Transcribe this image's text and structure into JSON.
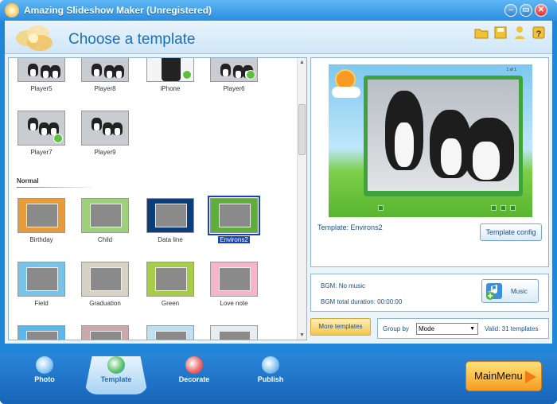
{
  "window": {
    "title": "Amazing Slideshow Maker (Unregistered)",
    "minimize_icon": "minimize-icon",
    "maximize_icon": "maximize-icon",
    "close_icon": "close-icon"
  },
  "header": {
    "title": "Choose a template",
    "icons": [
      "folder-icon",
      "save-icon",
      "user-icon",
      "help-icon"
    ]
  },
  "templates": {
    "section_label": "Normal",
    "top_row": [
      {
        "label": "Player5"
      },
      {
        "label": "Player8"
      },
      {
        "label": "iPhone"
      },
      {
        "label": "Player6"
      }
    ],
    "row2": [
      {
        "label": "Player7"
      },
      {
        "label": "Player9"
      }
    ],
    "normal_row1": [
      {
        "label": "Birthday",
        "color": "#e89b3a"
      },
      {
        "label": "Child",
        "color": "#9fd07a"
      },
      {
        "label": "Data line",
        "color": "#0e3e7a"
      },
      {
        "label": "Environs2",
        "color": "#5fae3d",
        "selected": true
      }
    ],
    "normal_row2": [
      {
        "label": "Field",
        "color": "#77c4e8"
      },
      {
        "label": "Graduation",
        "color": "#d8d2c4"
      },
      {
        "label": "Green",
        "color": "#a7cc48"
      },
      {
        "label": "Love note",
        "color": "#f3b7c8"
      }
    ]
  },
  "preview": {
    "counter": "1 of 1",
    "template_label": "Template:",
    "template_name": "Environs2",
    "template_config": "Template config",
    "bgm_label": "BGM:",
    "bgm_value": "No music",
    "bgm_total_label": "BGM total duration:",
    "bgm_total_value": "00:00:00",
    "music_button": "Music"
  },
  "filters": {
    "more_templates": "More templates",
    "group_by_label": "Group by",
    "group_by_value": "Mode",
    "valid_label": "Valid:",
    "valid_value": "31 templates"
  },
  "bottom": {
    "tabs": [
      {
        "label": "Photo",
        "icon": "photo-icon"
      },
      {
        "label": "Template",
        "icon": "template-icon",
        "active": true
      },
      {
        "label": "Decorate",
        "icon": "decorate-icon"
      },
      {
        "label": "Publish",
        "icon": "publish-icon"
      }
    ],
    "main_menu": "MainMenu"
  }
}
